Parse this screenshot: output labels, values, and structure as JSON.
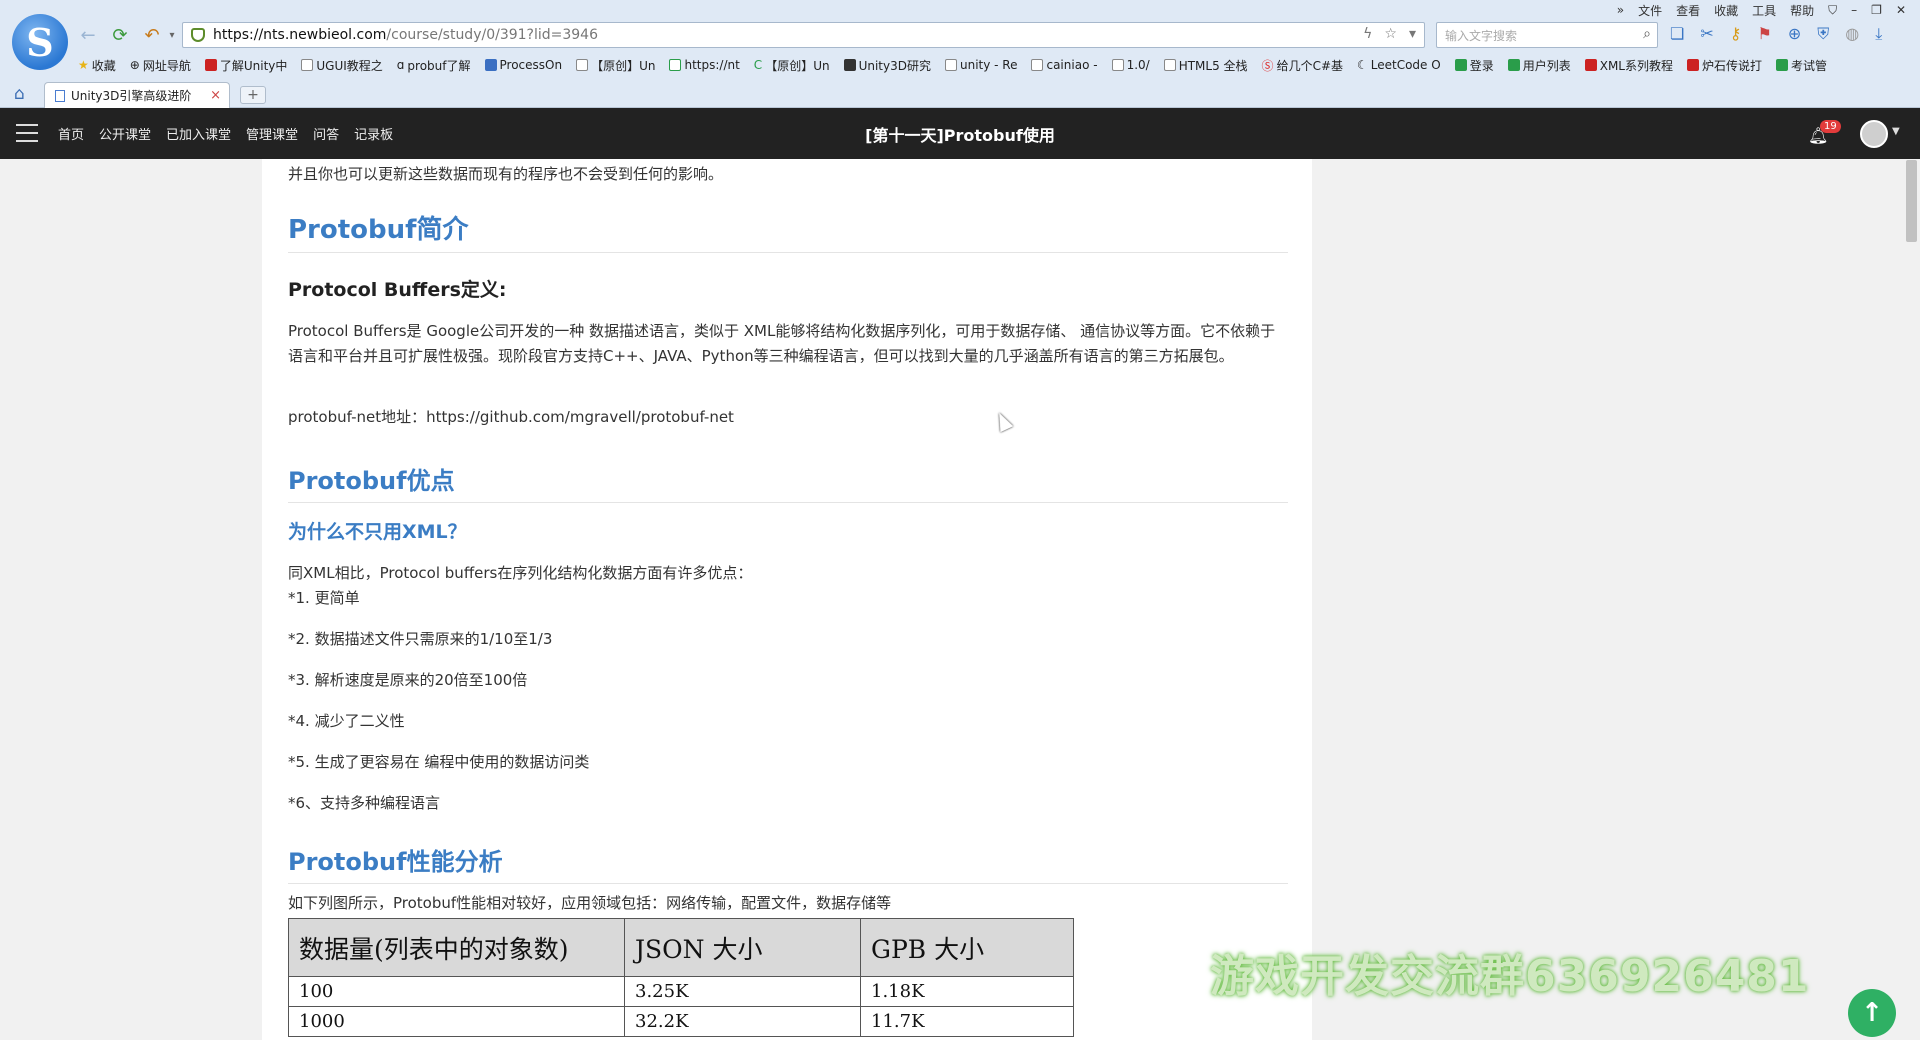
{
  "browser": {
    "logo_letter": "S",
    "topmenu": [
      "»",
      "文件",
      "查看",
      "收藏",
      "工具",
      "帮助"
    ],
    "url_host": "https://nts.newbieol.com",
    "url_path": "/course/study/0/391?lid=3946",
    "search_placeholder": "输入文字搜索",
    "bookmarks": [
      "收藏",
      "网址导航",
      "了解Unity中",
      "UGUI教程之",
      "probuf了解",
      "ProcessOn",
      "【原创】Un",
      "https://nt",
      "【原创】Un",
      "Unity3D研究",
      "unity - Re",
      "cainiao -",
      "1.0/",
      "HTML5 全栈",
      "给几个C#基",
      "LeetCode O",
      "登录",
      "用户列表",
      "XML系列教程",
      "炉石传说打",
      "考试管"
    ],
    "tab_title": "Unity3D引擎高级进阶",
    "tab_close": "×",
    "newtab_label": "+"
  },
  "site": {
    "nav": [
      "首页",
      "公开课堂",
      "已加入课堂",
      "管理课堂",
      "问答",
      "记录板"
    ],
    "title": "[第十一天]Protobuf使用",
    "notification_count": "19"
  },
  "article": {
    "intro_tail": "并且你也可以更新这些数据而现有的程序也不会受到任何的影响。",
    "h_intro": "Protobuf简介",
    "h_definition": "Protocol Buffers定义:",
    "definition_p1": "Protocol Buffers是 Google公司开发的一种 数据描述语言，类似于 XML能够将结构化数据序列化，可用于数据存储、 通信协议等方面。它不依赖于语言和平台并且可扩展性极强。现阶段官方支持C++、JAVA、Python等三种编程语言，但可以找到大量的几乎涵盖所有语言的第三方拓展包。",
    "definition_p2": "protobuf-net地址：https://github.com/mgravell/protobuf-net",
    "h_advantages": "Protobuf优点",
    "h_why": "为什么不只用XML？",
    "why_intro": "同XML相比，Protocol buffers在序列化结构化数据方面有许多优点：",
    "points": [
      "*1. 更简单",
      "*2. 数据描述文件只需原来的1/10至1/3",
      "*3. 解析速度是原来的20倍至100倍",
      "*4. 减少了二义性",
      "*5. 生成了更容易在 编程中使用的数据访问类",
      "*6、支持多种编程语言"
    ],
    "h_perf": "Protobuf性能分析",
    "perf_intro": "如下列图所示，Protobuf性能相对较好，应用领域包括：网络传输，配置文件，数据存储等",
    "table": {
      "headers": [
        "数据量(列表中的对象数)",
        "JSON 大小",
        "GPB 大小"
      ],
      "rows": [
        [
          "100",
          "3.25K",
          "1.18K"
        ],
        [
          "1000",
          "32.2K",
          "11.7K"
        ]
      ]
    }
  },
  "overlay": {
    "watermark": "游戏开发交流群636926481",
    "totop_icon": "↑"
  }
}
